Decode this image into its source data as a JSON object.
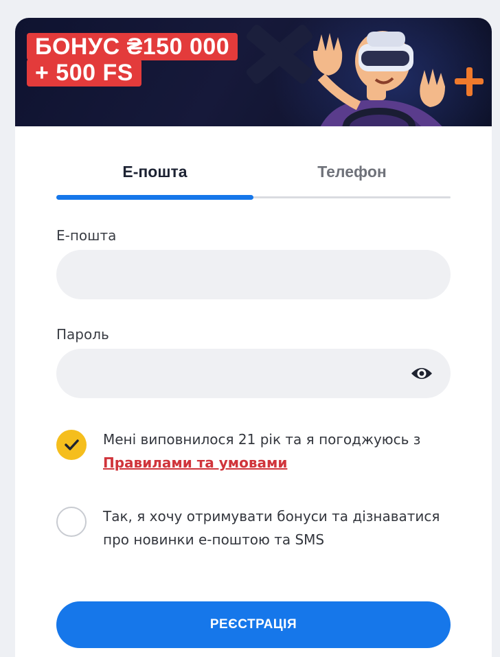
{
  "banner": {
    "promo_line1": "БОНУС ₴150 000",
    "promo_line2": "+ 500 FS"
  },
  "tabs": [
    {
      "label": "Е-пошта",
      "active": true
    },
    {
      "label": "Телефон",
      "active": false
    }
  ],
  "form": {
    "email_label": "Е-пошта",
    "email_value": "",
    "password_label": "Пароль",
    "password_value": "",
    "password_toggle_icon": "eye-icon"
  },
  "consents": [
    {
      "checked": true,
      "text": "Мені виповнилося 21 рік та я погоджуюсь з",
      "link": "Правилами та умовами"
    },
    {
      "checked": false,
      "text": "Так, я хочу отримувати бонуси та дізнаватися про новинки е-поштою та SMS"
    }
  ],
  "submit_label": "РЕЄСТРАЦІЯ",
  "colors": {
    "accent": "#1677ea",
    "check_on": "#f5be1d",
    "promo_bg": "#e33b3b",
    "link": "#d0343b"
  }
}
